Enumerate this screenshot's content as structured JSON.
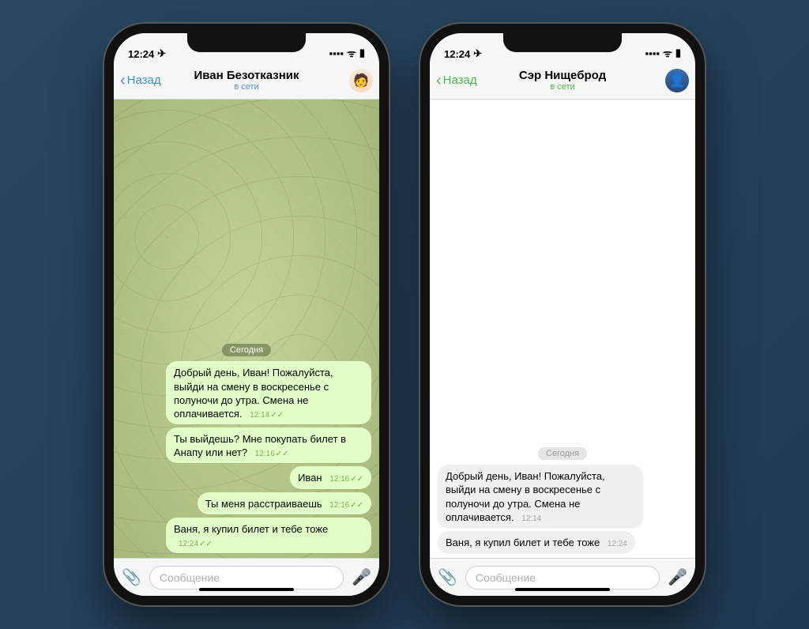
{
  "status": {
    "time": "12:24",
    "nav_glyph": "✈︎",
    "signal": "▪▪▪▪",
    "wifi": "ᯤ",
    "battery": "▮"
  },
  "common": {
    "back_label": "Назад",
    "online": "в сети",
    "date_sep": "Сегодня",
    "placeholder": "Сообщение",
    "ticks": "✓✓"
  },
  "left": {
    "title": "Иван Безотказник",
    "messages": [
      {
        "text": "Добрый день, Иван! Пожалуйста, выйди на смену в воскресенье с полуночи до утра. Смена не оплачивается.",
        "time": "12:14"
      },
      {
        "text": "Ты выйдешь? Мне покупать билет в Анапу или нет?",
        "time": "12:16"
      },
      {
        "text": "Иван",
        "time": "12:16"
      },
      {
        "text": "Ты меня расстраиваешь",
        "time": "12:16"
      },
      {
        "text": "Ваня, я купил билет и тебе тоже",
        "time": "12:24"
      }
    ]
  },
  "right": {
    "title": "Сэр Нищеброд",
    "messages": [
      {
        "text": "Добрый день, Иван! Пожалуйста, выйди на смену в воскресенье с полуночи до утра. Смена не оплачивается.",
        "time": "12:14"
      },
      {
        "text": "Ваня, я купил билет и тебе тоже",
        "time": "12:24"
      }
    ]
  }
}
